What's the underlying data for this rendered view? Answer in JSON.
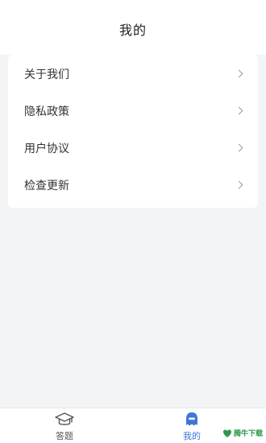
{
  "header": {
    "title": "我的"
  },
  "menu": {
    "items": [
      {
        "label": "关于我们"
      },
      {
        "label": "隐私政策"
      },
      {
        "label": "用户协议"
      },
      {
        "label": "检查更新"
      }
    ]
  },
  "tabbar": {
    "tabs": [
      {
        "label": "答题",
        "icon": "graduation-cap-icon",
        "active": false
      },
      {
        "label": "我的",
        "icon": "profile-icon",
        "active": true
      }
    ]
  },
  "watermark": {
    "text": "腾牛下载"
  },
  "colors": {
    "accent": "#3d76d8",
    "background": "#f3f4f5",
    "watermark": "#2d9a4a"
  }
}
